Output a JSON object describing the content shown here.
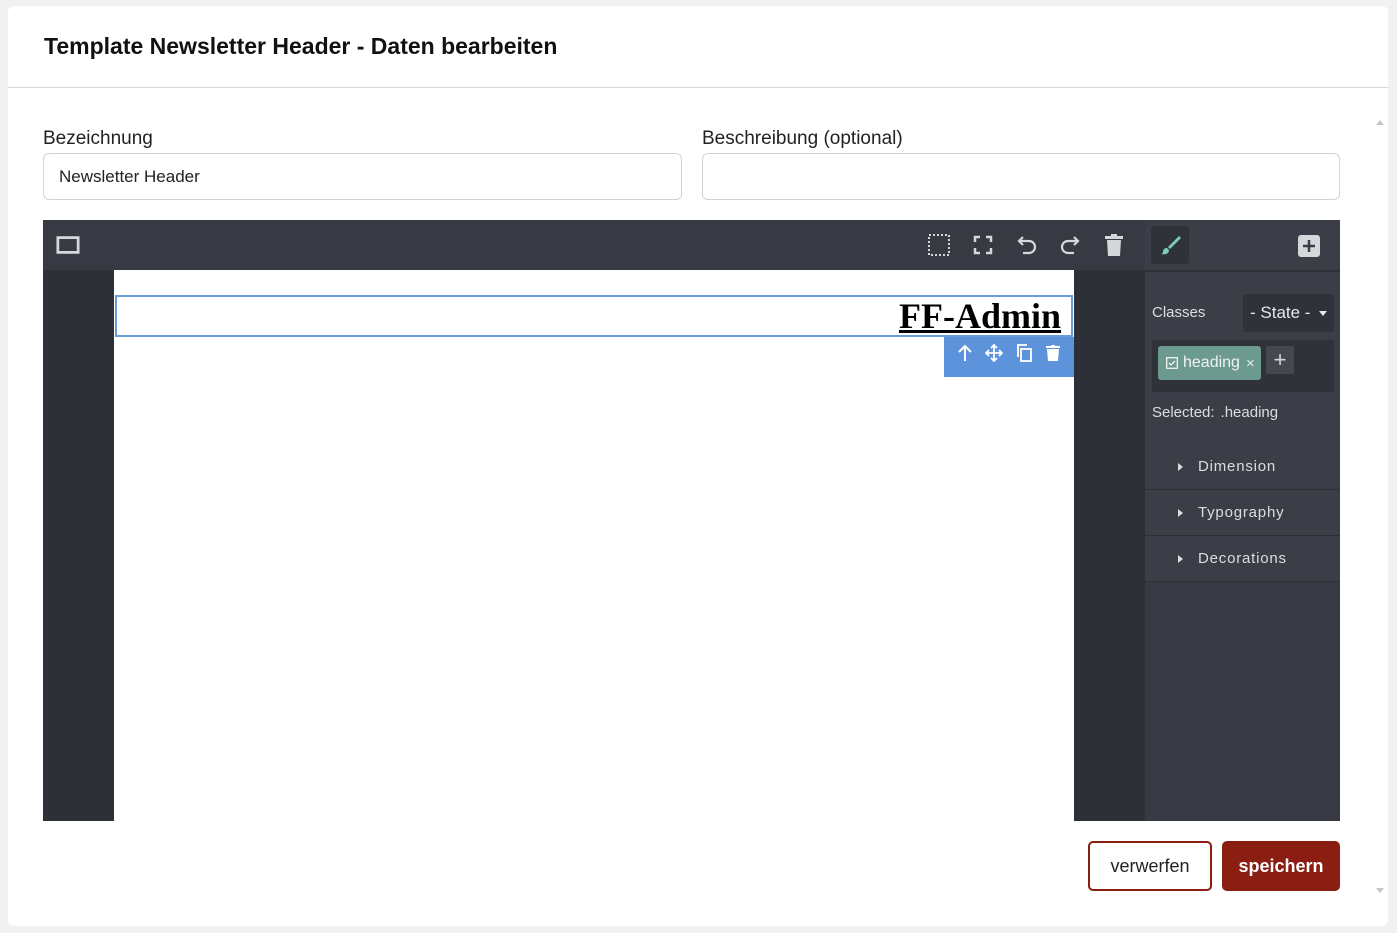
{
  "modal": {
    "title": "Template Newsletter Header - Daten bearbeiten"
  },
  "form": {
    "name_label": "Bezeichnung",
    "name_value": "Newsletter Header",
    "description_label": "Beschreibung (optional)",
    "description_value": ""
  },
  "editor": {
    "toolbar_icons": [
      "device-desktop-icon",
      "sw-visibility-icon",
      "fullscreen-icon",
      "undo-icon",
      "redo-icon",
      "trash-icon"
    ],
    "canvas": {
      "heading_text": "FF-Admin"
    },
    "block_toolbar_icons": [
      "arrow-up-icon",
      "move-icon",
      "copy-icon",
      "trash-icon"
    ],
    "panel": {
      "tabs": [
        "paint-brush-icon",
        "plus-square-icon"
      ],
      "classes_label": "Classes",
      "state_label": "- State -",
      "tag_label": "heading",
      "tag_close": "×",
      "tag_add": "+",
      "selected_label": "Selected:",
      "selected_value": ".heading",
      "sectors": [
        {
          "label": "Dimension"
        },
        {
          "label": "Typography"
        },
        {
          "label": "Decorations"
        }
      ]
    },
    "colors": {
      "panel_bg": "#3b3e46",
      "selection": "#6a9cdc",
      "tag": "#6c9a8e",
      "accent": "#7ccbbd"
    }
  },
  "actions": {
    "discard_label": "verwerfen",
    "save_label": "speichern",
    "primary_color": "#8b1e12"
  }
}
